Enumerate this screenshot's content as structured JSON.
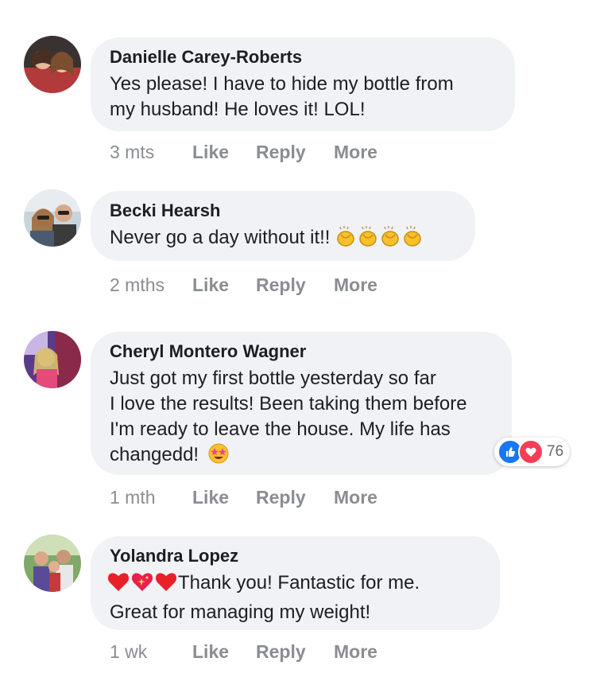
{
  "comments": [
    {
      "author": "Danielle Carey-Roberts",
      "text_lines": [
        "Yes please! I have to hide my bottle from",
        "my husband! He loves it! LOL!"
      ],
      "time": "3 mts",
      "actions": [
        "Like",
        "Reply",
        "More"
      ]
    },
    {
      "author": "Becki Hearsh",
      "text": "Never go a day without it!!",
      "emojis": [
        "clapping-hands",
        "clapping-hands",
        "clapping-hands",
        "clapping-hands"
      ],
      "time": "2 mths",
      "actions": [
        "Like",
        "Reply",
        "More"
      ]
    },
    {
      "author": "Cheryl Montero Wagner",
      "text_lines": [
        "Just got my first bottle yesterday so far",
        "I love the results! Been taking them before",
        "I'm ready to leave the house. My life has",
        "changedd!"
      ],
      "emojis": [
        "star-struck"
      ],
      "time": "1 mth",
      "actions": [
        "Like",
        "Reply",
        "More"
      ],
      "reactions": {
        "icons": [
          "like",
          "love"
        ],
        "count": "76"
      }
    },
    {
      "author": "Yolandra Lopez",
      "emojis": [
        "red-heart",
        "sparkling-heart",
        "red-heart"
      ],
      "text_lines": [
        "Thank you! Fantastic for me.",
        "Great for managing my weight!"
      ],
      "time": "1 wk",
      "actions": [
        "Like",
        "Reply",
        "More"
      ]
    }
  ],
  "colors": {
    "bubble": "#f0f2f5",
    "meta_text": "#8a8d91",
    "like_blue": "#1877f2",
    "love_red": "#f33e58"
  }
}
